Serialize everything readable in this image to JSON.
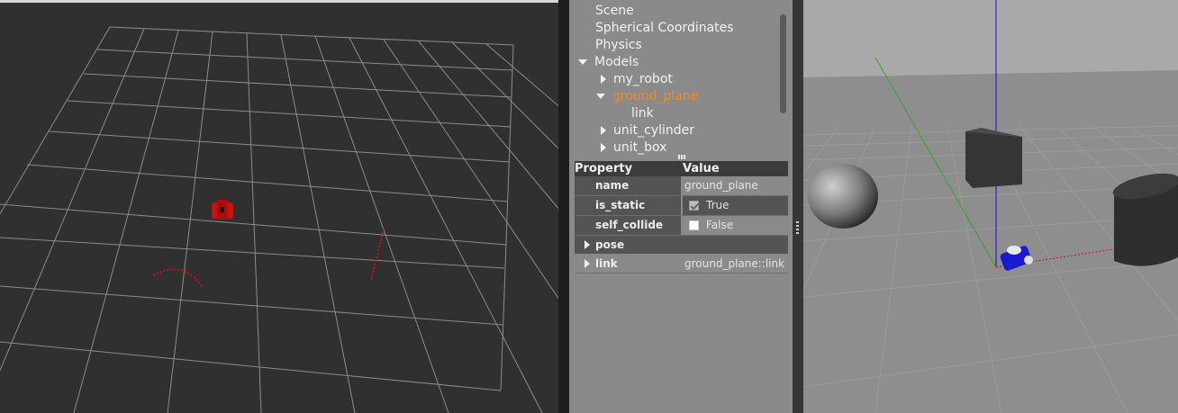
{
  "tree": {
    "items": [
      {
        "label": "Scene"
      },
      {
        "label": "Spherical Coordinates"
      },
      {
        "label": "Physics"
      },
      {
        "label": "Models"
      },
      {
        "label": "my_robot"
      },
      {
        "label": "ground_plane"
      },
      {
        "label": "link"
      },
      {
        "label": "unit_cylinder"
      },
      {
        "label": "unit_box"
      }
    ]
  },
  "properties": {
    "header": {
      "property": "Property",
      "value": "Value"
    },
    "rows": [
      {
        "key": "name",
        "value": "ground_plane"
      },
      {
        "key": "is_static",
        "value": "True",
        "checked": true
      },
      {
        "key": "self_collide",
        "value": "False",
        "checked": false
      }
    ],
    "groups": [
      {
        "key": "pose",
        "value": ""
      },
      {
        "key": "link",
        "value": "ground_plane::link"
      }
    ]
  },
  "colors": {
    "selected_text": "#f08a24",
    "panel_bg": "#8a8a8a",
    "rviz_bg": "#303030",
    "gazebo_sky": "#a9a9a9",
    "robot_rviz": "#d01010",
    "robot_gazebo": "#1010c8"
  },
  "icons": [
    "expanded-triangle-icon",
    "collapsed-triangle-icon",
    "checkbox-icon"
  ]
}
